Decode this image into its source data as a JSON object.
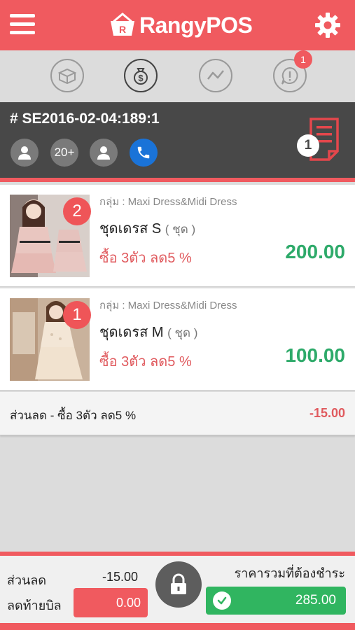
{
  "app": {
    "logo_text": "RangyPOS"
  },
  "icons": {
    "menu": "hamburger-icon",
    "settings": "gear-icon",
    "tabs": [
      "box-icon",
      "money-bag-icon",
      "chart-line-icon",
      "alert-chat-icon"
    ],
    "customer": "user-icon",
    "staff": "user-icon",
    "phone": "phone-icon",
    "receipt": "receipt-icon",
    "lock": "lock-icon",
    "check": "check-circle-icon"
  },
  "tabs": {
    "alert_badge": "1"
  },
  "order": {
    "id": "# SE2016-02-04:189:1",
    "guest_count": "20+",
    "receipt_badge": "1"
  },
  "items": [
    {
      "qty": "2",
      "group": "กลุ่ม : Maxi Dress&Midi Dress",
      "name": "ชุดเดรส S",
      "unit": "( ชุด )",
      "promo": "ซื้อ 3ตัว ลด5 %",
      "price": "200.00"
    },
    {
      "qty": "1",
      "group": "กลุ่ม : Maxi Dress&Midi Dress",
      "name": "ชุดเดรส M",
      "unit": "( ชุด )",
      "promo": "ซื้อ 3ตัว ลด5 %",
      "price": "100.00"
    }
  ],
  "discount_row": {
    "label": "ส่วนลด - ซื้อ 3ตัว ลด5 %",
    "amount": "-15.00"
  },
  "footer": {
    "discount_label": "ส่วนลด",
    "discount_value": "-15.00",
    "bill_discount_label": "ลดท้ายบิล",
    "bill_discount_value": "0.00",
    "total_label": "ราคารวมที่ต้องชำระ",
    "total_value": "285.00"
  },
  "colors": {
    "brand_red": "#f05a5f",
    "dark_bar": "#484848",
    "price_green": "#2eaa6a",
    "pay_green": "#30b560",
    "phone_blue": "#1a73d8"
  }
}
